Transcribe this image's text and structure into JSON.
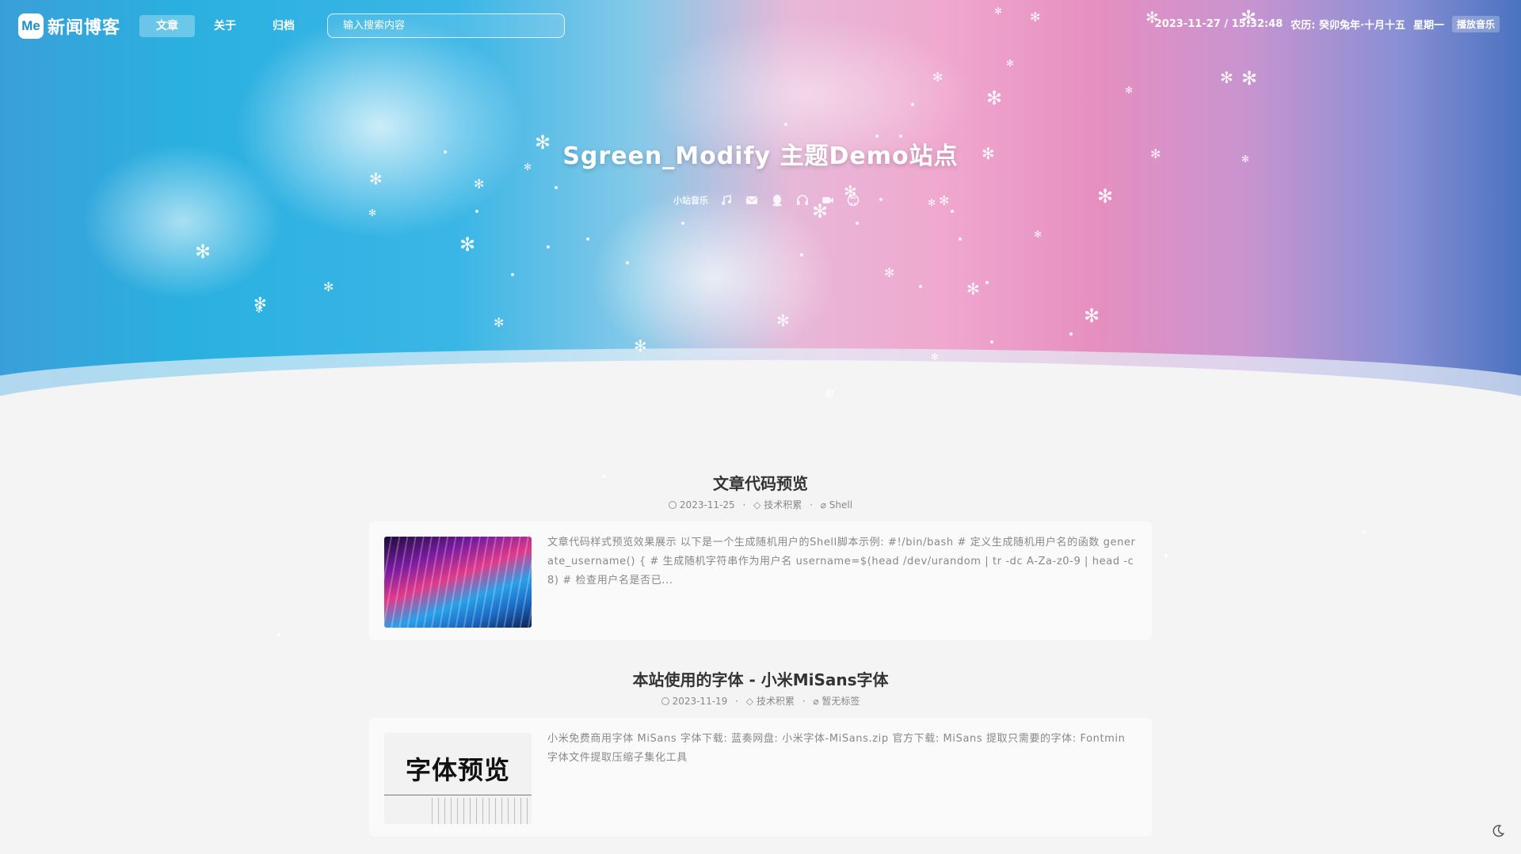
{
  "nav": {
    "logo_badge": "Me",
    "logo_text": "新闻博客",
    "tabs": [
      {
        "label": "文章",
        "active": true
      },
      {
        "label": "关于",
        "active": false
      },
      {
        "label": "归档",
        "active": false
      }
    ],
    "search_placeholder": "输入搜索内容"
  },
  "topinfo": {
    "datetime": "2023-11-27 / 15:32:48",
    "lunar": "农历: 癸卯兔年·十月十五",
    "weekday": "星期一",
    "music_button": "播放音乐"
  },
  "hero": {
    "title": "Sgreen_Modify 主题Demo站点",
    "social_text": "小站音乐",
    "social_icons": [
      "music-icon",
      "mail-icon",
      "qq-icon",
      "headphones-icon",
      "video-icon",
      "github-icon"
    ]
  },
  "posts": [
    {
      "title": "文章代码预览",
      "date": "2023-11-25",
      "category": "技术积累",
      "tag": "Shell",
      "excerpt": "文章代码样式预览效果展示 以下是一个生成随机用户的Shell脚本示例: #!/bin/bash # 定义生成随机用户名的函数 generate_username() { # 生成随机字符串作为用户名 username=$(head /dev/urandom | tr -dc A-Za-z0-9 | head -c 8) # 检查用户名是否已..."
    },
    {
      "title": "本站使用的字体 - 小米MiSans字体",
      "date": "2023-11-19",
      "category": "技术积累",
      "tag": "暂无标签",
      "thumb_text": "字体预览",
      "excerpt": "小米免费商用字体 MiSans 字体下载: 蓝奏网盘: 小米字体-MiSans.zip 官方下载: MiSans 提取只需要的字体: Fontmin 字体文件提取压缩子集化工具"
    }
  ],
  "colors": {
    "accent": "#1a8ec5",
    "page_bg": "#f4f4f5",
    "card_bg": "#fafafa"
  }
}
